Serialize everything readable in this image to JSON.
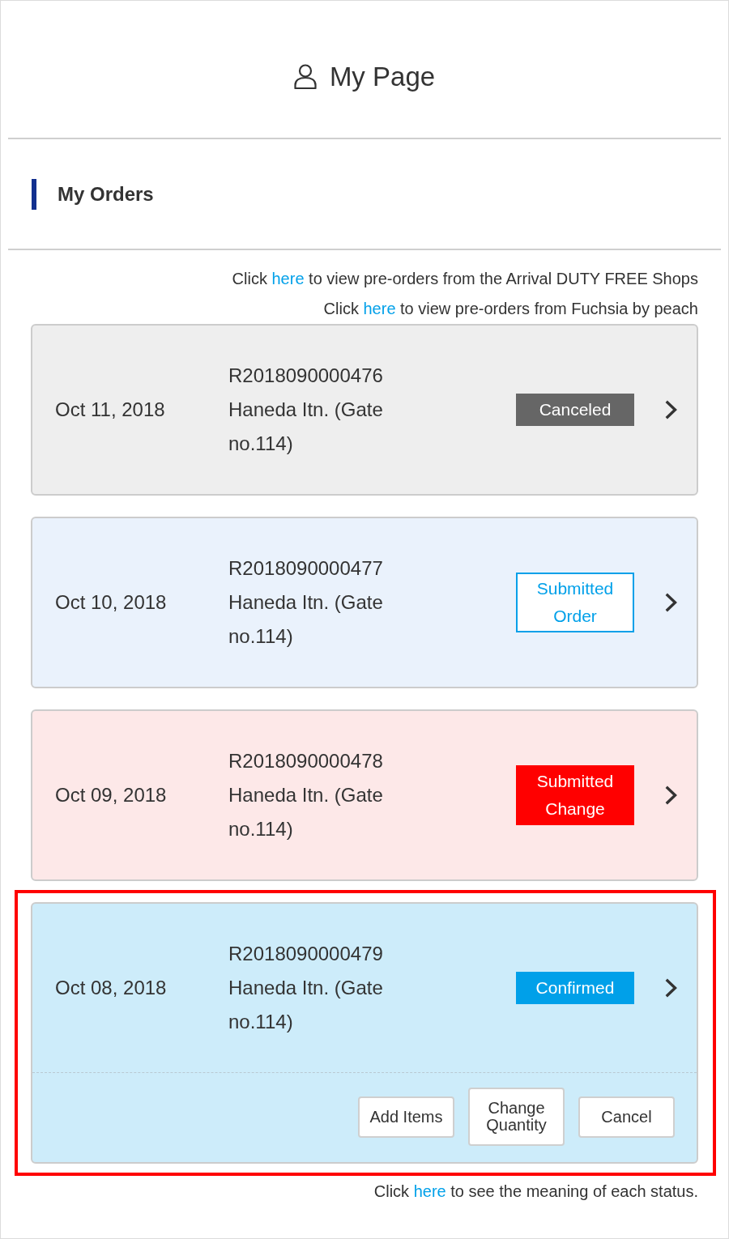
{
  "header": {
    "title": "My Page"
  },
  "section": {
    "title": "My Orders"
  },
  "notices": [
    {
      "text_before": "Click",
      "link": "here",
      "text_after": "to view pre-orders from the Arrival DUTY FREE Shops"
    },
    {
      "text_before": "Click",
      "link": "here",
      "text_after": "to view pre-orders from Fuchsia by peach"
    }
  ],
  "orders": [
    {
      "date": "Oct 11, 2018",
      "order_number": "R2018090000476",
      "location": "Haneda Itn. (Gate no.114)",
      "status": {
        "label": "Canceled",
        "kind": "canceled"
      },
      "highlighted": false
    },
    {
      "date": "Oct 10, 2018",
      "order_number": "R2018090000477",
      "location": "Haneda Itn. (Gate no.114)",
      "status": {
        "label": "Submitted Order",
        "kind": "submitted"
      },
      "highlighted": false
    },
    {
      "date": "Oct 09, 2018",
      "order_number": "R2018090000478",
      "location": "Haneda Itn. (Gate no.114)",
      "status": {
        "label": "Submitted Change",
        "kind": "changed"
      },
      "highlighted": false
    },
    {
      "date": "Oct 08, 2018",
      "order_number": "R2018090000479",
      "location": "Haneda Itn. (Gate no.114)",
      "status": {
        "label": "Confirmed",
        "kind": "confirmed"
      },
      "highlighted": true,
      "actions": [
        "Add Items",
        "Change Quantity",
        "Cancel"
      ]
    }
  ],
  "footer_note": {
    "text_before": "Click",
    "link": "here",
    "text_after": "to see the meaning of each status."
  }
}
